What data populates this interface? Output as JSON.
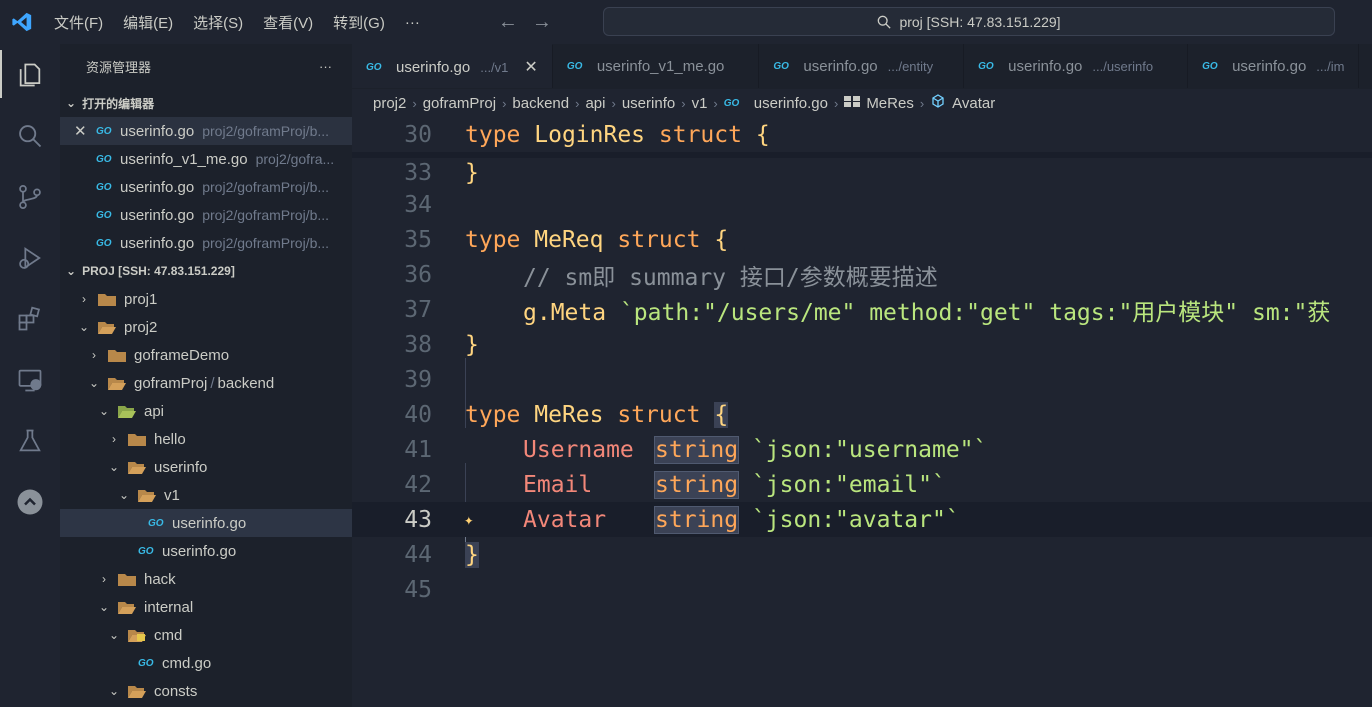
{
  "menu": [
    "文件(F)",
    "编辑(E)",
    "选择(S)",
    "查看(V)",
    "转到(G)",
    "···"
  ],
  "search": {
    "text": "proj [SSH: 47.83.151.229]"
  },
  "activity": [
    "explorer-icon",
    "search-icon",
    "source-control-icon",
    "run-debug-icon",
    "extensions-icon",
    "remote-explorer-icon",
    "testing-icon",
    "gitlens-icon"
  ],
  "sidebar": {
    "title": "资源管理器",
    "more": "···",
    "open_editors_title": "打开的编辑器",
    "open_editors": [
      {
        "name": "userinfo.go",
        "path": "proj2/goframProj/b..."
      },
      {
        "name": "userinfo_v1_me.go",
        "path": "proj2/gofra..."
      },
      {
        "name": "userinfo.go",
        "path": "proj2/goframProj/b..."
      },
      {
        "name": "userinfo.go",
        "path": "proj2/goframProj/b..."
      },
      {
        "name": "userinfo.go",
        "path": "proj2/goframProj/b..."
      }
    ],
    "workspace_title": "PROJ [SSH: 47.83.151.229]",
    "tree": {
      "proj1": "proj1",
      "proj2": "proj2",
      "goframeDemo": "goframeDemo",
      "goframProj": "goframProj",
      "slash": "/",
      "backend": "backend",
      "api": "api",
      "hello": "hello",
      "userinfo": "userinfo",
      "v1": "v1",
      "userinfo_go_v1": "userinfo.go",
      "userinfo_go": "userinfo.go",
      "hack": "hack",
      "internal": "internal",
      "cmd": "cmd",
      "cmd_go": "cmd.go",
      "consts": "consts"
    },
    "go_badge": "GO"
  },
  "tabs": [
    {
      "name": "userinfo.go",
      "desc": ".../v1",
      "close": "✕"
    },
    {
      "name": "userinfo_v1_me.go",
      "desc": ""
    },
    {
      "name": "userinfo.go",
      "desc": ".../entity"
    },
    {
      "name": "userinfo.go",
      "desc": ".../userinfo"
    },
    {
      "name": "userinfo.go",
      "desc": ".../im"
    }
  ],
  "breadcrumb": [
    "proj2",
    "goframProj",
    "backend",
    "api",
    "userinfo",
    "v1",
    "userinfo.go",
    "MeRes",
    "Avatar"
  ],
  "code": {
    "line_numbers": [
      "30",
      "33",
      "34",
      "35",
      "36",
      "37",
      "38",
      "39",
      "40",
      "41",
      "42",
      "43",
      "44",
      "45"
    ],
    "l30": {
      "kw": "type",
      "name": "LoginRes",
      "kw2": "struct",
      "brace": "{"
    },
    "l33": {
      "brace": "}"
    },
    "l35": {
      "kw": "type",
      "name": "MeReq",
      "kw2": "struct",
      "brace": "{"
    },
    "l36": {
      "comment": "// sm即 summary 接口/参数概要描述"
    },
    "l37": {
      "pkg": "g.Meta",
      "tag": "`path:\"/users/me\" method:\"get\" tags:\"用户模块\" sm:\"获"
    },
    "l38": {
      "brace": "}"
    },
    "l40": {
      "kw": "type",
      "name": "MeRes",
      "kw2": "struct",
      "brace": "{"
    },
    "l41": {
      "field": "Username",
      "type": "string",
      "tag": "`json:\"username\"`"
    },
    "l42": {
      "field": "Email",
      "type": "string",
      "tag": "`json:\"email\"`"
    },
    "l43": {
      "field": "Avatar",
      "type": "string",
      "tag": "`json:\"avatar\"`"
    },
    "l44": {
      "brace": "}"
    }
  }
}
